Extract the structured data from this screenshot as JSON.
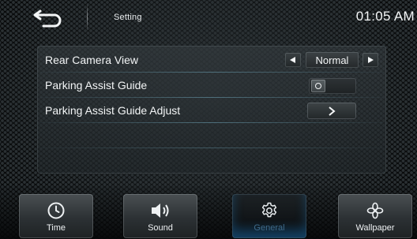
{
  "header": {
    "back_icon": "back-arrow-icon",
    "title": "Setting",
    "clock": "01:05 AM"
  },
  "settings": {
    "rows": [
      {
        "label": "Rear Camera View",
        "control": "selector",
        "value": "Normal",
        "left_icon": "left-triangle-icon",
        "right_icon": "right-triangle-icon"
      },
      {
        "label": "Parking Assist Guide",
        "control": "toggle",
        "state": "off",
        "knob_icon": "circle-icon"
      },
      {
        "label": "Parking Assist Guide Adjust",
        "control": "navigate",
        "icon": "chevron-right-icon"
      }
    ]
  },
  "dock": {
    "items": [
      {
        "label": "Time",
        "icon": "clock-icon",
        "active": false
      },
      {
        "label": "Sound",
        "icon": "speaker-icon",
        "active": false
      },
      {
        "label": "General",
        "icon": "gear-icon",
        "active": true
      },
      {
        "label": "Wallpaper",
        "icon": "wallpaper-icon",
        "active": false
      }
    ]
  },
  "colors": {
    "background": "#15191b",
    "text": "#f3f5f6",
    "separator": "#6ea5b9",
    "active_glow": "#1e6eaa",
    "active_label": "#3f6a8a"
  }
}
